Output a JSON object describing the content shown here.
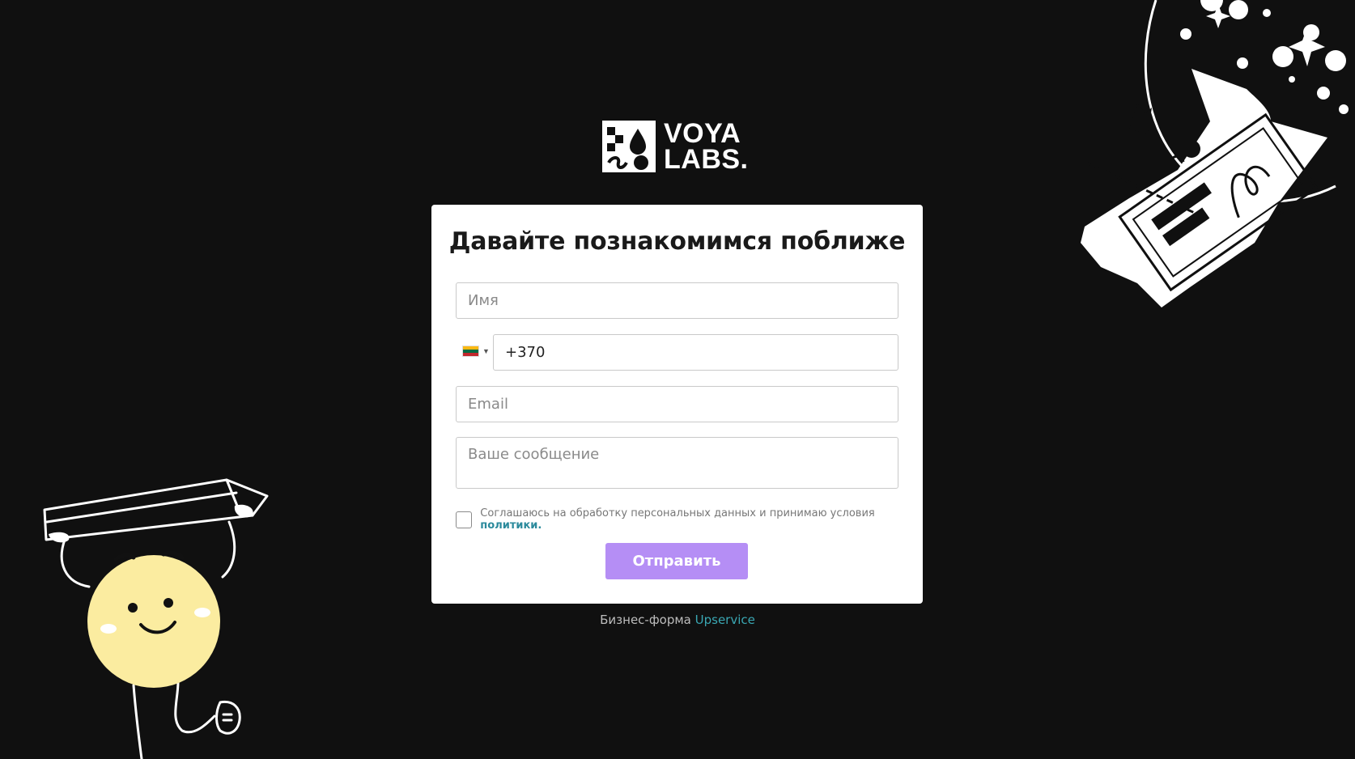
{
  "brand": {
    "logo_line1": "VOYA",
    "logo_line2": "LABS."
  },
  "form": {
    "title": "Давайте познакомимся поближе",
    "name_placeholder": "Имя",
    "phone_country_icon": "lithuania-flag-icon",
    "phone_value": "+370",
    "email_placeholder": "Email",
    "message_placeholder": "Ваше сообщение",
    "consent_text": "Соглашаюсь на обработку персональных данных и принимаю условия ",
    "consent_link": "политики.",
    "consent_checked": false,
    "submit_label": "Отправить"
  },
  "footer": {
    "prefix": "Бизнес-форма ",
    "link": "Upservice"
  },
  "colors": {
    "background": "#101010",
    "submit_button": "#b58ef5",
    "link_teal": "#3aa7b3",
    "mascot_face": "#fbeca0"
  },
  "decorations": [
    "smiling-mascot-holding-pencil-illustration",
    "ticket-with-stars-illustration"
  ]
}
